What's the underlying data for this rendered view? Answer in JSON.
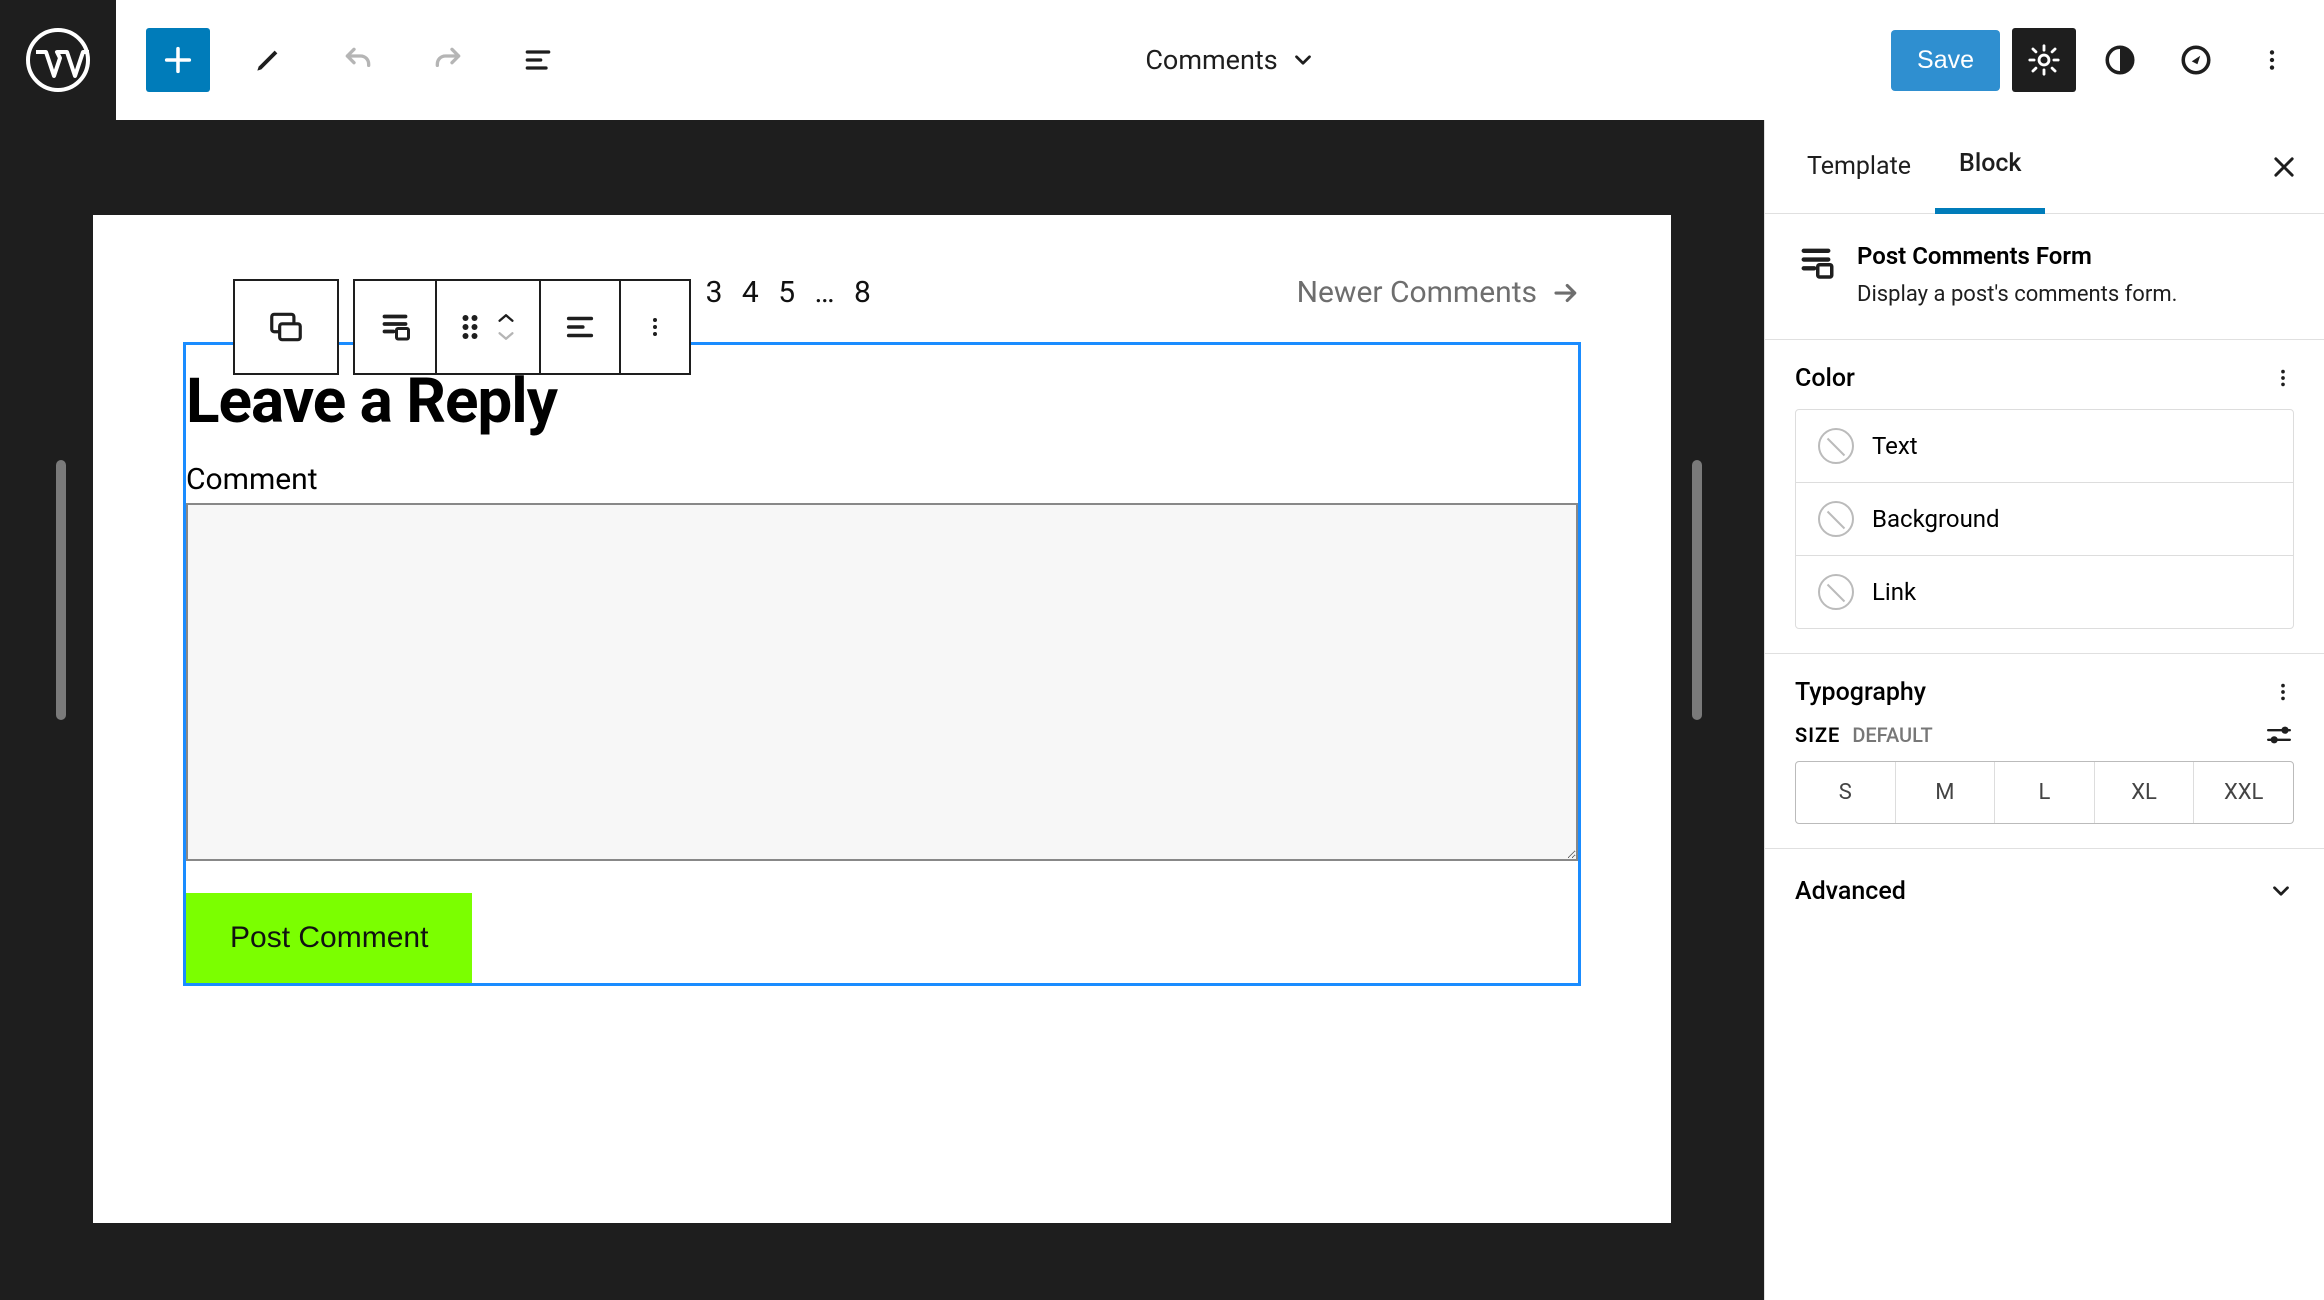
{
  "toolbar": {
    "document_title": "Comments",
    "save_label": "Save"
  },
  "canvas": {
    "pagination": {
      "numbers": "1 2 3 4 5 … 8",
      "newer_label": "Newer Comments"
    },
    "reply_heading": "Leave a Reply",
    "comment_label": "Comment",
    "post_comment_label": "Post Comment"
  },
  "sidebar": {
    "tabs": {
      "template": "Template",
      "block": "Block"
    },
    "block_name": "Post Comments Form",
    "block_desc": "Display a post's comments form.",
    "color_panel": {
      "title": "Color",
      "rows": {
        "text": "Text",
        "background": "Background",
        "link": "Link"
      }
    },
    "typo_panel": {
      "title": "Typography",
      "size_label": "SIZE",
      "size_default": "DEFAULT",
      "sizes": {
        "s": "S",
        "m": "M",
        "l": "L",
        "xl": "XL",
        "xxl": "XXL"
      }
    },
    "advanced_label": "Advanced"
  }
}
